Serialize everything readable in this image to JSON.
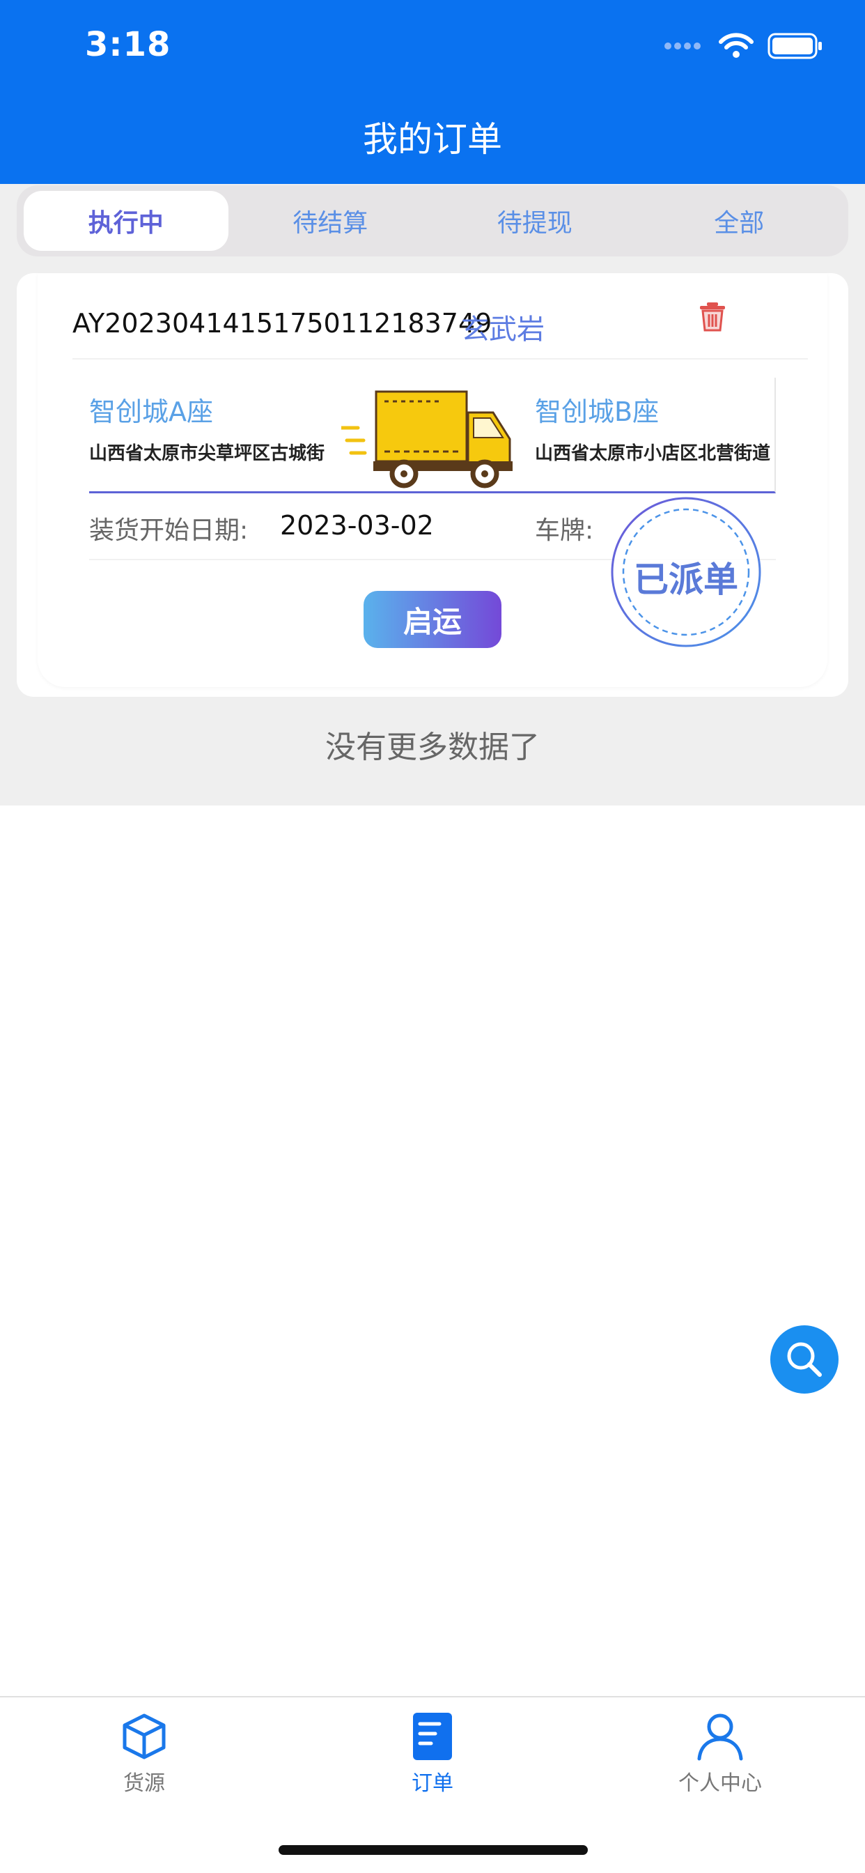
{
  "status_bar": {
    "time": "3:18"
  },
  "header": {
    "title": "我的订单"
  },
  "tabs": [
    {
      "label": "执行中",
      "active": true
    },
    {
      "label": "待结算",
      "active": false
    },
    {
      "label": "待提现",
      "active": false
    },
    {
      "label": "全部",
      "active": false
    }
  ],
  "order": {
    "order_no": "AY20230414151750112183749",
    "product": "玄武岩",
    "from": {
      "name": "智创城A座",
      "address": "山西省太原市尖草坪区古城街"
    },
    "to": {
      "name": "智创城B座",
      "address": "山西省太原市小店区北营街道"
    },
    "load_date_label": "装货开始日期:",
    "load_date": "2023-03-02",
    "plate_label": "车牌:",
    "stamp": "已派单",
    "start_button": "启运"
  },
  "list_end_text": "没有更多数据了",
  "bottom_nav": [
    {
      "label": "货源",
      "icon": "cube-icon",
      "active": false
    },
    {
      "label": "订单",
      "icon": "document-icon",
      "active": true
    },
    {
      "label": "个人中心",
      "icon": "user-icon",
      "active": false
    }
  ],
  "colors": {
    "header": "#0a72f0",
    "accent": "#5d63d6",
    "link": "#5aa1e6",
    "nav_active": "#1070ee"
  }
}
